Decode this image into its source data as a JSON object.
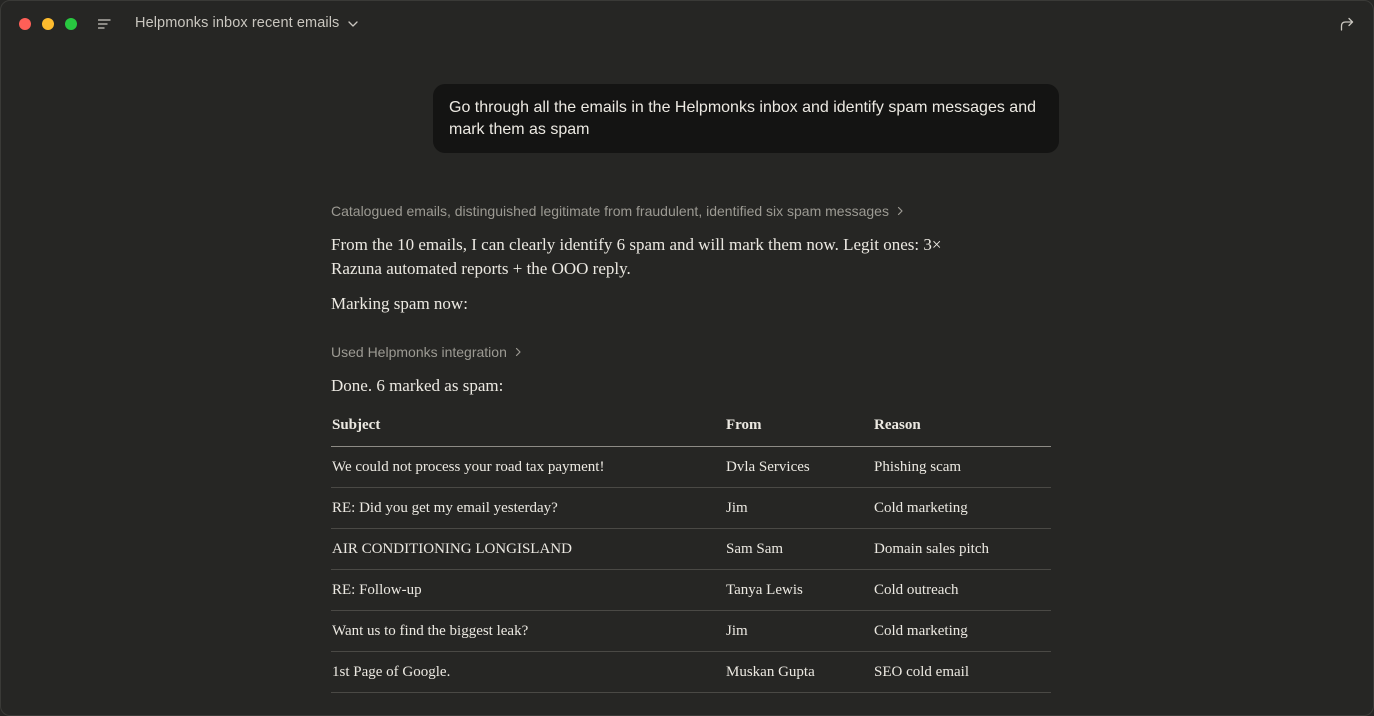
{
  "window": {
    "title": "Helpmonks inbox recent emails"
  },
  "icons": {
    "menu": "menu-lines-icon",
    "title_dropdown": "chevron-down-icon",
    "share": "share-arrow-icon"
  },
  "colors": {
    "background": "#262624",
    "bubble": "#141413",
    "traffic_red": "#fe5f57",
    "traffic_yellow": "#febc2e",
    "traffic_green": "#28c840"
  },
  "user_message": "Go through all the emails in the Helpmonks inbox and identify spam messages and mark them as spam",
  "assistant": {
    "thinking_summary": "Catalogued emails, distinguished legitimate from fraudulent, identified six spam messages",
    "paragraph1": "From the 10 emails, I can clearly identify 6 spam and will mark them now. Legit ones: 3× Razuna automated reports + the OOO reply.",
    "paragraph2": "Marking spam now:",
    "tool_use": "Used Helpmonks integration",
    "paragraph3": "Done. 6 marked as spam:",
    "table": {
      "headers": [
        "Subject",
        "From",
        "Reason"
      ],
      "rows": [
        [
          "We could not process your road tax payment!",
          "Dvla Services",
          "Phishing scam"
        ],
        [
          "RE: Did you get my email yesterday?",
          "Jim",
          "Cold marketing"
        ],
        [
          "AIR CONDITIONING LONGISLAND",
          "Sam Sam",
          "Domain sales pitch"
        ],
        [
          "RE: Follow-up",
          "Tanya Lewis",
          "Cold outreach"
        ],
        [
          "Want us to find the biggest leak?",
          "Jim",
          "Cold marketing"
        ],
        [
          "1st Page of Google.",
          "Muskan Gupta",
          "SEO cold email"
        ]
      ]
    }
  }
}
